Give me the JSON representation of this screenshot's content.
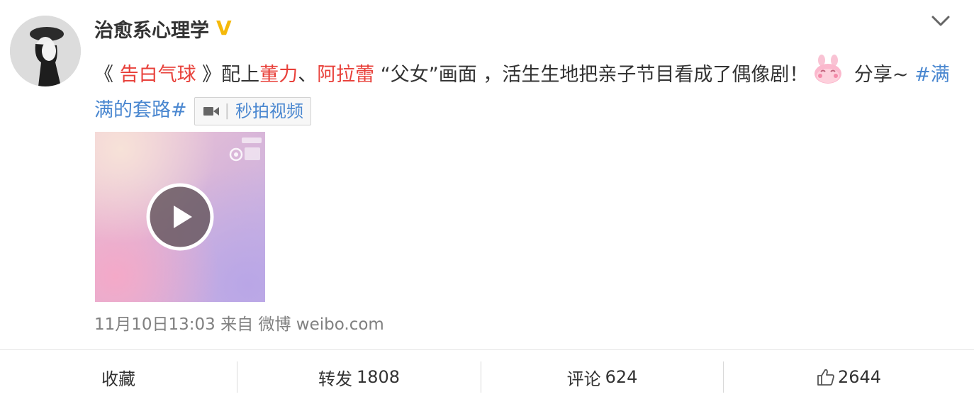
{
  "post": {
    "author": "治愈系心理学",
    "verified_badge": "V",
    "text": {
      "open_quote": "《 ",
      "show_title": "告白气球",
      "close_quote": " 》配上",
      "person1": "董力",
      "comma": "、",
      "person2": "阿拉蕾",
      "mid": " “父女”画面 ，活生生地把亲子节目看成了偶像剧！",
      "after_emoji": " 分享~ ",
      "hashtag": "#满满的套路#"
    },
    "video_tag": {
      "icon": "video-camera-icon",
      "label": "秒拍视频"
    },
    "thumbnail": {
      "watermark": "秒拍",
      "play_icon": "play-icon"
    },
    "meta": {
      "time": "11月10日13:03",
      "from_label": "来自",
      "source": "微博 weibo.com"
    }
  },
  "actions": {
    "favorite": {
      "label": "收藏"
    },
    "repost": {
      "label": "转发",
      "count": "1808"
    },
    "comment": {
      "label": "评论",
      "count": "624"
    },
    "like": {
      "icon": "thumbs-up-icon",
      "count": "2644"
    }
  },
  "colors": {
    "accent_blue": "#4a87d0",
    "accent_red": "#e8403a",
    "verified_gold": "#f5b90a"
  }
}
